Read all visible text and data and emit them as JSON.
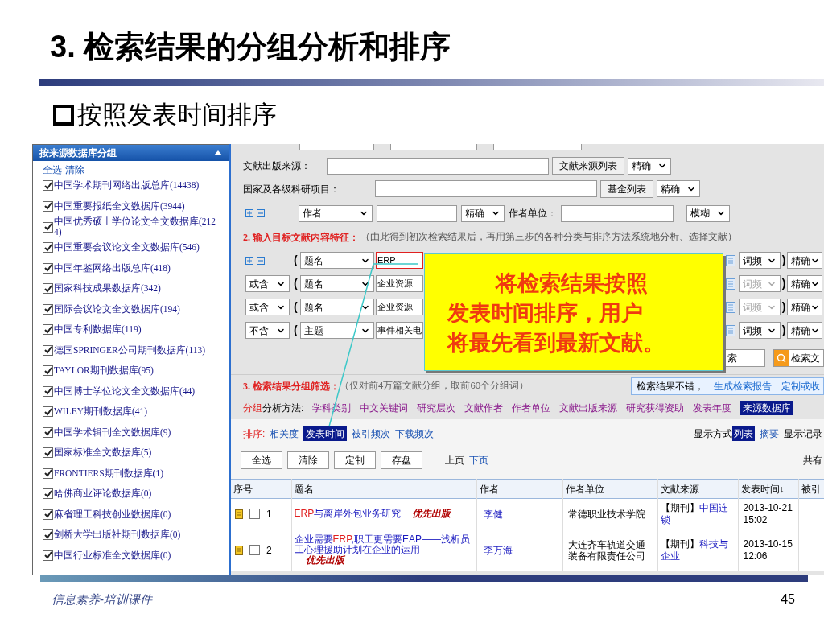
{
  "slide": {
    "title": "3. 检索结果的分组分析和排序",
    "subtitle": "按照发表时间排序",
    "footer": "信息素养-培训课件",
    "page_number": "45"
  },
  "sidebar": {
    "title": "按来源数据库分组",
    "links": [
      "全选",
      "清除"
    ],
    "items": [
      {
        "label": "中国学术期刊网络出版总库(14438)",
        "checked": true
      },
      {
        "label": "中国重要报纸全文数据库(3944)",
        "checked": true
      },
      {
        "label": "中国优秀硕士学位论文全文数据库(2124)",
        "checked": true
      },
      {
        "label": "中国重要会议论文全文数据库(546)",
        "checked": true
      },
      {
        "label": "中国年鉴网络出版总库(418)",
        "checked": true
      },
      {
        "label": "国家科技成果数据库(342)",
        "checked": true
      },
      {
        "label": "国际会议论文全文数据库(194)",
        "checked": true
      },
      {
        "label": "中国专利数据库(119)",
        "checked": true
      },
      {
        "label": "德国SPRINGER公司期刊数据库(113)",
        "checked": true
      },
      {
        "label": "TAYLOR期刊数据库(95)",
        "checked": true
      },
      {
        "label": "中国博士学位论文全文数据库(44)",
        "checked": true
      },
      {
        "label": "WILEY期刊数据库(41)",
        "checked": true
      },
      {
        "label": "中国学术辑刊全文数据库(9)",
        "checked": true
      },
      {
        "label": "国家标准全文数据库(5)",
        "checked": true
      },
      {
        "label": "FRONTIERS期刊数据库(1)",
        "checked": true
      },
      {
        "label": "哈佛商业评论数据库(0)",
        "checked": true
      },
      {
        "label": "麻省理工科技创业数据库(0)",
        "checked": true
      },
      {
        "label": "剑桥大学出版社期刊数据库(0)",
        "checked": true
      },
      {
        "label": "中国行业标准全文数据库(0)",
        "checked": true
      }
    ]
  },
  "search_form": {
    "source_row": {
      "label": "文献出版来源：",
      "button": "文献来源列表",
      "match": "精确"
    },
    "fund_row": {
      "label": "国家及各级科研项目：",
      "button": "基金列表",
      "match": "精确"
    },
    "author_row": {
      "field": "作者",
      "match": "精确",
      "unit_label": "作者单位：",
      "unit_match": "模糊"
    },
    "step2_title": "2. 输入目标文献内容特征：",
    "step2_note": "（由此得到初次检索结果后，再用第三步的各种分类与排序方法系统地分析、选择文献）",
    "conditions": [
      {
        "open": "(",
        "close": ")",
        "field": "题名",
        "value": "ERP",
        "freq": "词频",
        "disabled": false,
        "match": "精确"
      },
      {
        "logic": "或含",
        "open": "(",
        "close": ")",
        "field": "题名",
        "value": "企业资源",
        "freq": "词频",
        "disabled": true,
        "match": "精确"
      },
      {
        "logic": "或含",
        "open": "(",
        "close": ")",
        "field": "题名",
        "value": "企业资源",
        "freq": "词频",
        "disabled": true,
        "match": "精确"
      },
      {
        "logic": "不含",
        "open": "(",
        "close": ")",
        "field": "主题",
        "value": "事件相关电",
        "freq": "词频",
        "disabled": false,
        "match": "精确"
      }
    ],
    "search_button": "索",
    "doc_search_button": "检索文"
  },
  "callout": {
    "lines": [
      "将检索结果按照",
      "发表时间排序，用户",
      "将最先看到最新文献。"
    ]
  },
  "results": {
    "step3_title": "3. 检索结果分组筛选：",
    "step3_note": "（仅对前4万篇文献分组，取前60个分组词）",
    "report": {
      "text": "检索结果不错，",
      "links": [
        "生成检索报告",
        "定制或收"
      ]
    },
    "group_label_a": "分组",
    "group_label_b": "分析方法:",
    "methods": [
      {
        "label": "学科类别",
        "selected": false
      },
      {
        "label": "中文关键词",
        "selected": false
      },
      {
        "label": "研究层次",
        "selected": false
      },
      {
        "label": "文献作者",
        "selected": false
      },
      {
        "label": "作者单位",
        "selected": false
      },
      {
        "label": "文献出版来源",
        "selected": false
      },
      {
        "label": "研究获得资助",
        "selected": false
      },
      {
        "label": "发表年度",
        "selected": false
      },
      {
        "label": "来源数据库",
        "selected": true
      }
    ],
    "sort_label": "排序:",
    "sorts": [
      {
        "label": "相关度",
        "selected": false
      },
      {
        "label": "发表时间",
        "selected": true
      },
      {
        "label": "被引频次",
        "selected": false
      },
      {
        "label": "下载频次",
        "selected": false
      }
    ],
    "display_label": "显示方式",
    "views": [
      {
        "label": "列表",
        "selected": true
      },
      {
        "label": "摘要",
        "selected": false
      }
    ],
    "records_label": "显示记录",
    "buttons": [
      "全选",
      "清除",
      "定制",
      "存盘"
    ],
    "pager": [
      "上页",
      "下页"
    ],
    "total_label": "共有",
    "table": {
      "columns": [
        "序号",
        "题名",
        "作者",
        "作者单位",
        "文献来源",
        "发表时间↓",
        "被引"
      ],
      "rows": [
        {
          "index": "1",
          "checked": false,
          "title": [
            {
              "text": "ERP",
              "highlight": true
            },
            {
              "text": "与离岸外包业务研究",
              "highlight": false
            }
          ],
          "badge": "优先出版",
          "author": "李健",
          "unit": "常德职业技术学院",
          "source_type": "【期刊】",
          "source": "中国连锁",
          "date": "2013-10-21 15:02"
        },
        {
          "index": "2",
          "checked": false,
          "title": [
            {
              "text": "企业需要",
              "highlight": false
            },
            {
              "text": "ERP",
              "highlight": true
            },
            {
              "text": ",职工更需要EAP——浅析员工心理援助计划在企业的运用",
              "highlight": false
            }
          ],
          "badge": "优先出版",
          "author": "李万海",
          "unit": "大连齐车轨道交通装备有限责任公司",
          "source_type": "【期刊】",
          "source": "科技与企业",
          "date": "2013-10-15 12:06"
        }
      ]
    }
  }
}
